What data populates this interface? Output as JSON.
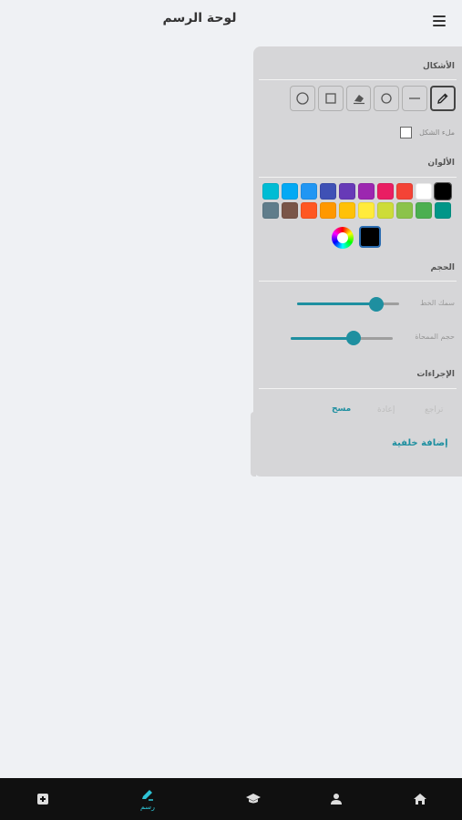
{
  "header": {
    "title": "لوحة الرسم",
    "menu_icon": "hamburger-menu-icon"
  },
  "panel": {
    "shapes_title": "الأشكال",
    "tools": [
      {
        "name": "pencil",
        "icon": "pencil-icon",
        "active": true
      },
      {
        "name": "line",
        "icon": "line-icon",
        "active": false
      },
      {
        "name": "circle",
        "icon": "circle-icon",
        "active": false
      },
      {
        "name": "eraser",
        "icon": "eraser-icon",
        "active": false
      },
      {
        "name": "square",
        "icon": "square-icon",
        "active": false
      },
      {
        "name": "circle-outline",
        "icon": "circle-outline-icon",
        "active": false
      }
    ],
    "fill_shapes_label": "ملء الشكل",
    "fill_shapes_checked": false,
    "colors_title": "الألوان",
    "colors_row1": [
      "#000000",
      "#ffffff",
      "#f44336",
      "#e91e63",
      "#9c27b0",
      "#673ab7",
      "#3f51b5",
      "#2196f3",
      "#03a9f4",
      "#00bcd4"
    ],
    "colors_row2": [
      "#009688",
      "#4caf50",
      "#8bc34a",
      "#cddc39",
      "#ffeb3b",
      "#ffc107",
      "#ff9800",
      "#ff5722",
      "#795548",
      "#607d8b"
    ],
    "selected_color": "#000000",
    "size_title": "الحجم",
    "stroke_width_label": "سمك الخط",
    "stroke_width_value": 0.78,
    "eraser_size_label": "حجم الممحاة",
    "eraser_size_value": 0.62,
    "actions_title": "الإجراءات",
    "undo_label": "تراجع",
    "redo_label": "إعادة",
    "clear_label": "مسح",
    "add_background_label": "إضافة خلفية"
  },
  "bottom_nav": {
    "items": [
      {
        "icon": "home-icon"
      },
      {
        "icon": "person-icon"
      },
      {
        "icon": "graduation-cap-icon"
      },
      {
        "icon": "draw-icon",
        "label": "رسم",
        "active": true
      },
      {
        "icon": "add-note-icon"
      }
    ]
  }
}
